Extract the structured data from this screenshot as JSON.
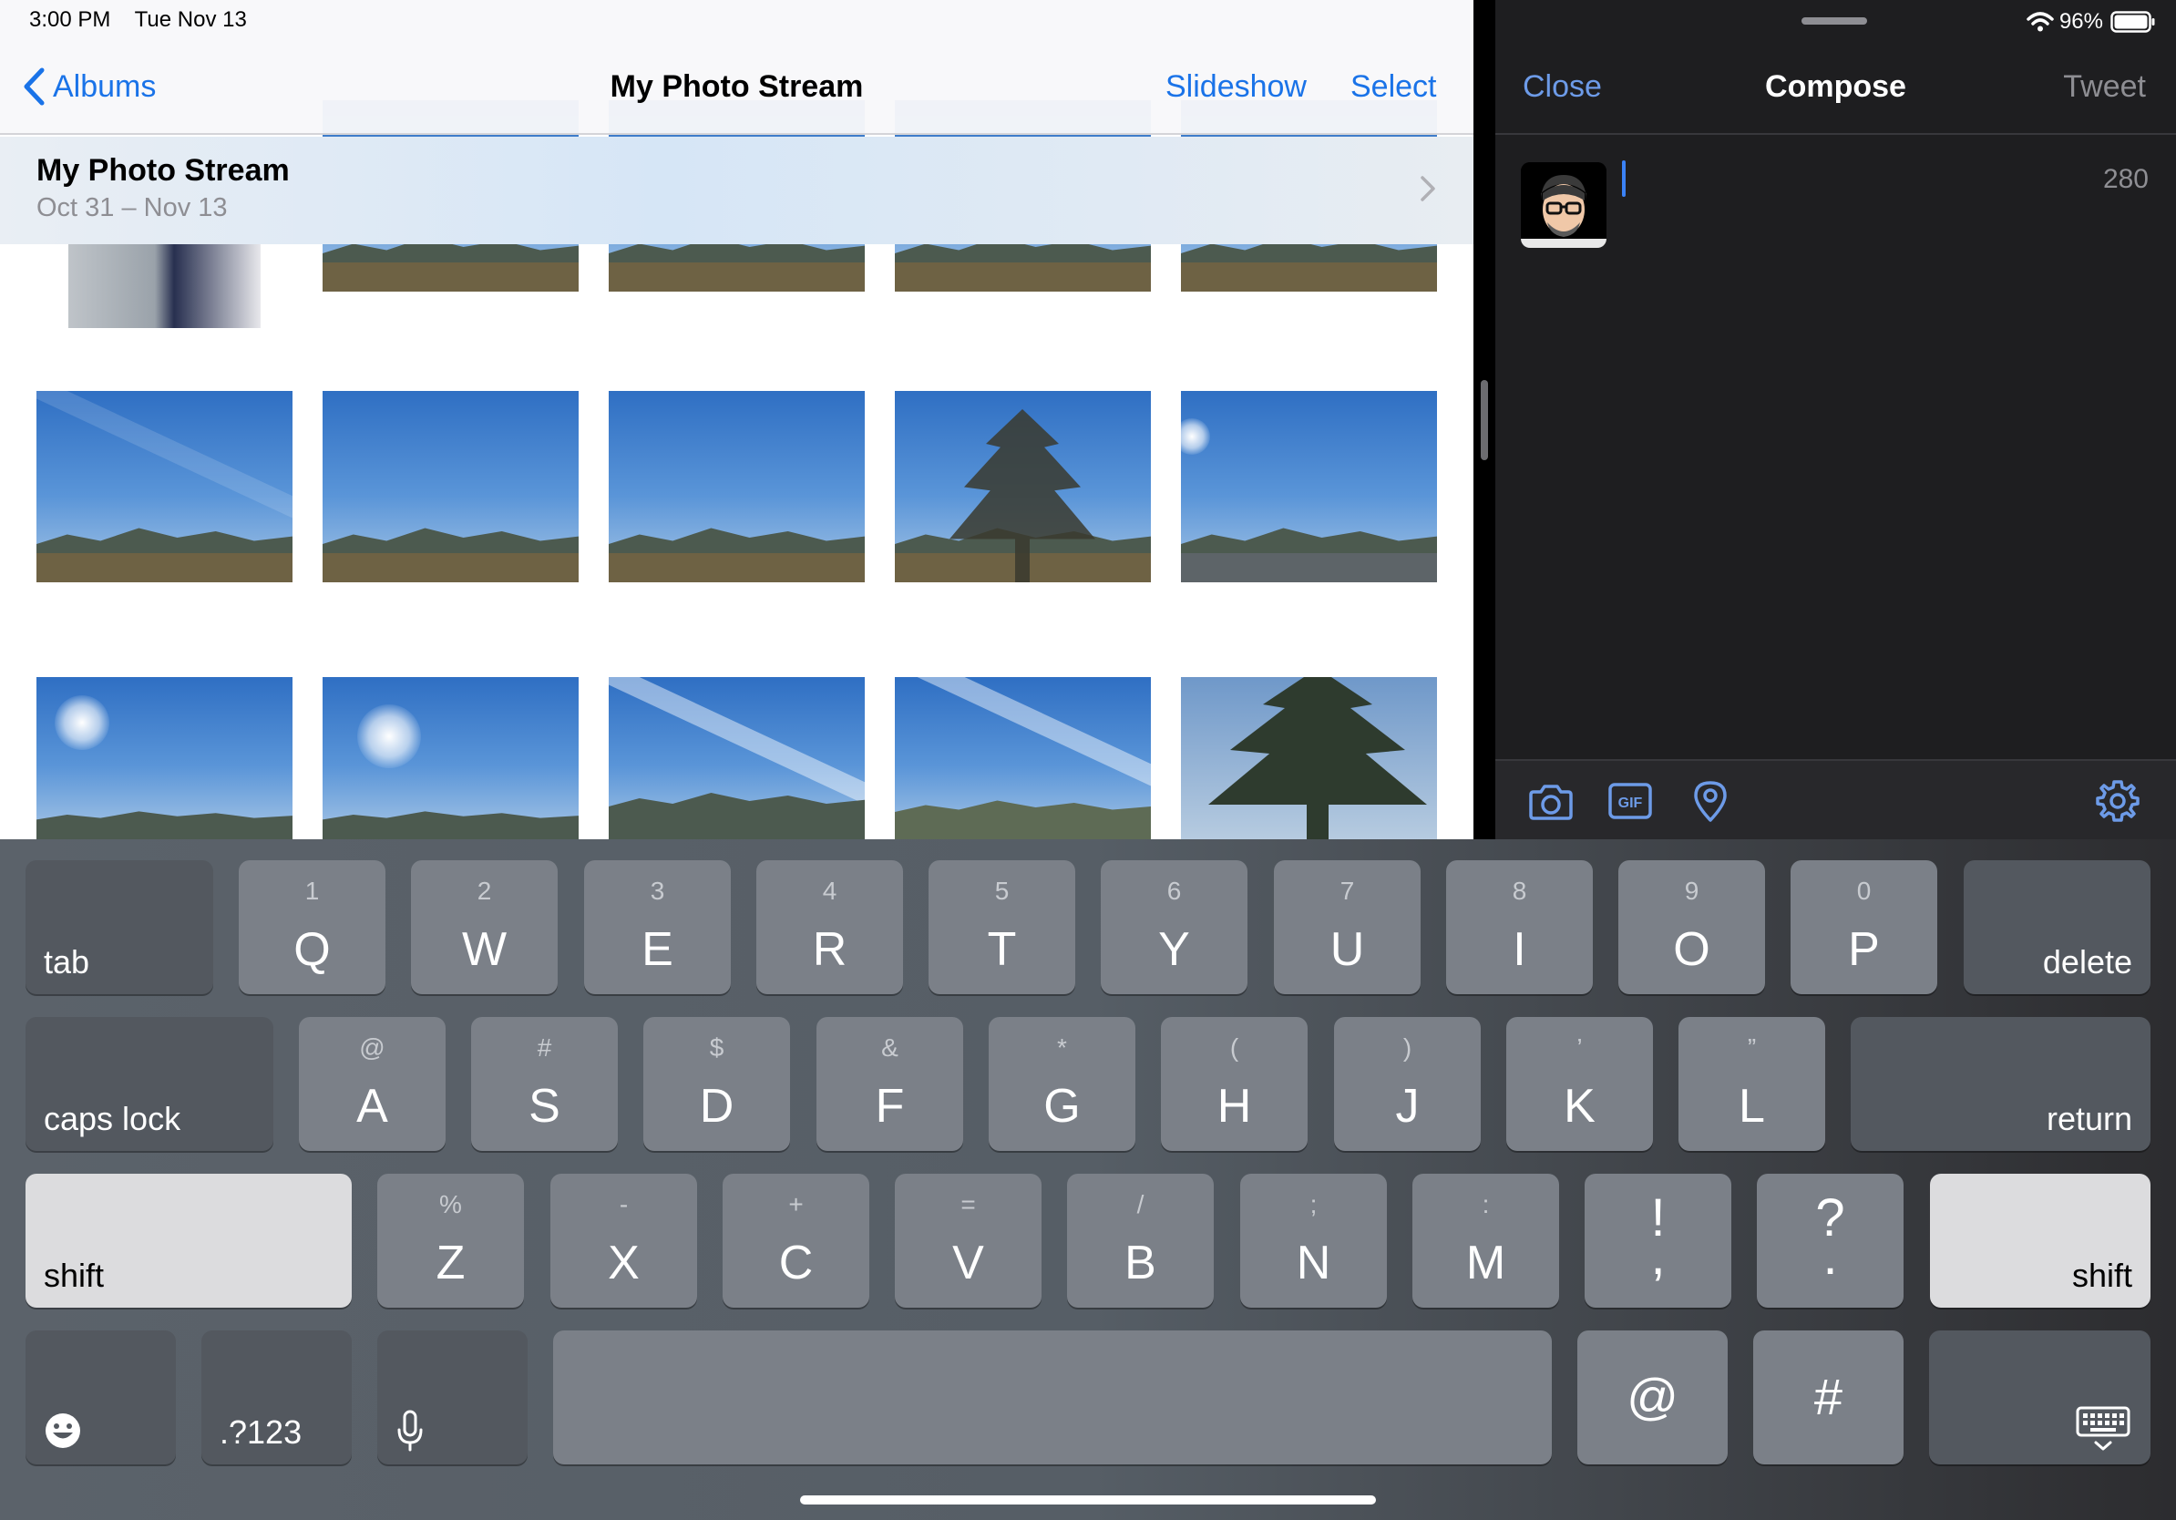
{
  "status_bar": {
    "time": "3:00 PM",
    "date": "Tue Nov 13",
    "battery": "96%"
  },
  "photos": {
    "back_label": "Albums",
    "title": "My Photo Stream",
    "slideshow_label": "Slideshow",
    "select_label": "Select",
    "section_title": "My Photo Stream",
    "section_date": "Oct 31 – Nov 13"
  },
  "compose": {
    "close_label": "Close",
    "title": "Compose",
    "tweet_label": "Tweet",
    "char_count": "280"
  },
  "keyboard": {
    "row1": [
      {
        "sec": "1",
        "key": "Q"
      },
      {
        "sec": "2",
        "key": "W"
      },
      {
        "sec": "3",
        "key": "E"
      },
      {
        "sec": "4",
        "key": "R"
      },
      {
        "sec": "5",
        "key": "T"
      },
      {
        "sec": "6",
        "key": "Y"
      },
      {
        "sec": "7",
        "key": "U"
      },
      {
        "sec": "8",
        "key": "I"
      },
      {
        "sec": "9",
        "key": "O"
      },
      {
        "sec": "0",
        "key": "P"
      }
    ],
    "row2": [
      {
        "sec": "@",
        "key": "A"
      },
      {
        "sec": "#",
        "key": "S"
      },
      {
        "sec": "$",
        "key": "D"
      },
      {
        "sec": "&",
        "key": "F"
      },
      {
        "sec": "*",
        "key": "G"
      },
      {
        "sec": "(",
        "key": "H"
      },
      {
        "sec": ")",
        "key": "J"
      },
      {
        "sec": "’",
        "key": "K"
      },
      {
        "sec": "”",
        "key": "L"
      }
    ],
    "row3": [
      {
        "sec": "%",
        "key": "Z"
      },
      {
        "sec": "-",
        "key": "X"
      },
      {
        "sec": "+",
        "key": "C"
      },
      {
        "sec": "=",
        "key": "V"
      },
      {
        "sec": "/",
        "key": "B"
      },
      {
        "sec": ";",
        "key": "N"
      },
      {
        "sec": ":",
        "key": "M"
      }
    ],
    "punct1": {
      "top": "!",
      "bottom": ","
    },
    "punct2": {
      "top": "?",
      "bottom": "."
    },
    "tab_label": "tab",
    "delete_label": "delete",
    "caps_label": "caps lock",
    "return_label": "return",
    "shift_label": "shift",
    "numbers_label": ".?123",
    "at_label": "@",
    "hash_label": "#"
  },
  "icons": {
    "back": "chevron-left-icon",
    "disclosure": "chevron-right-icon",
    "wifi": "wifi-icon",
    "battery": "battery-icon",
    "camera": "camera-icon",
    "gif": "gif-icon",
    "location": "location-pin-icon",
    "settings": "gear-icon",
    "emoji": "emoji-icon",
    "mic": "microphone-icon",
    "hide_keyboard": "keyboard-dismiss-icon"
  },
  "colors": {
    "accent": "#1a73e8",
    "compose_accent": "#6d9be8",
    "compose_bg": "#1e1e20"
  }
}
